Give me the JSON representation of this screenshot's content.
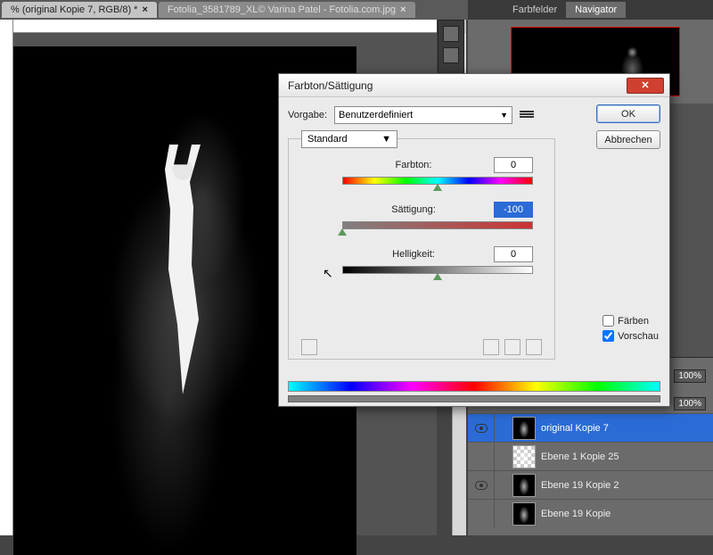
{
  "tabs": [
    {
      "label": "% (original Kopie 7, RGB/8) *",
      "active": true
    },
    {
      "label": "Fotolia_3581789_XL© Varina Patel - Fotolia.com.jpg",
      "active": false
    }
  ],
  "right_panel": {
    "tabs": {
      "swatches": "Farbfelder",
      "navigator": "Navigator"
    }
  },
  "layers": {
    "opacity_pct": "100%",
    "fill_pct": "100%",
    "items": [
      {
        "name": "original Kopie 7",
        "selected": true,
        "visible": true
      },
      {
        "name": "Ebene 1 Kopie 25",
        "selected": false,
        "visible": false
      },
      {
        "name": "Ebene 19 Kopie 2",
        "selected": false,
        "visible": true
      },
      {
        "name": "Ebene 19 Kopie",
        "selected": false,
        "visible": false
      }
    ]
  },
  "dialog": {
    "title": "Farbton/Sättigung",
    "preset_label": "Vorgabe:",
    "preset_value": "Benutzerdefiniert",
    "edit_value": "Standard",
    "ok": "OK",
    "cancel": "Abbrechen",
    "hue_label": "Farbton:",
    "hue_value": "0",
    "sat_label": "Sättigung:",
    "sat_value": "-100",
    "light_label": "Helligkeit:",
    "light_value": "0",
    "colorize": "Färben",
    "preview": "Vorschau"
  }
}
